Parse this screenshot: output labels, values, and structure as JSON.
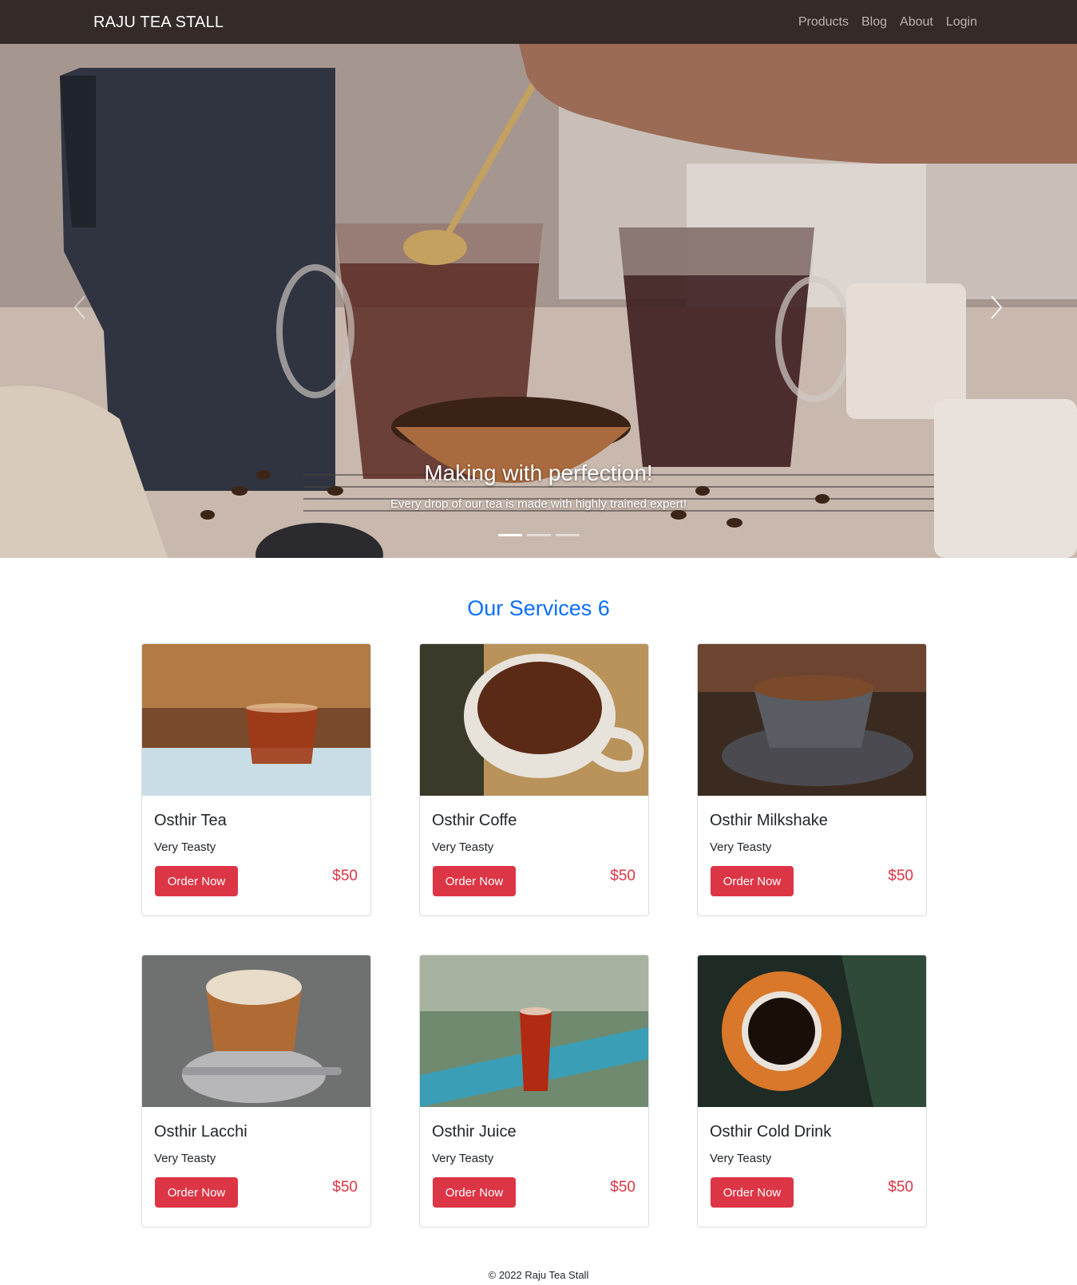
{
  "navbar": {
    "brand": "RAJU TEA STALL",
    "links": [
      "Products",
      "Blog",
      "About",
      "Login"
    ]
  },
  "hero": {
    "title": "Making with perfection!",
    "text": "Every drop of our tea is made with highly trained expert!",
    "slide_count": 3,
    "active_slide": 1,
    "prev_icon": "chevron-left-icon",
    "next_icon": "chevron-right-icon"
  },
  "services": {
    "title": "Our Services 6",
    "cards": [
      {
        "title": "Osthir Tea",
        "text": "Very Teasty",
        "button": "Order Now",
        "price": "$50"
      },
      {
        "title": "Osthir Coffe",
        "text": "Very Teasty",
        "button": "Order Now",
        "price": "$50"
      },
      {
        "title": "Osthir Milkshake",
        "text": "Very Teasty",
        "button": "Order Now",
        "price": "$50"
      },
      {
        "title": "Osthir Lacchi",
        "text": "Very Teasty",
        "button": "Order Now",
        "price": "$50"
      },
      {
        "title": "Osthir Juice",
        "text": "Very Teasty",
        "button": "Order Now",
        "price": "$50"
      },
      {
        "title": "Osthir Cold Drink",
        "text": "Very Teasty",
        "button": "Order Now",
        "price": "$50"
      }
    ]
  },
  "footer": {
    "text": "© 2022 Raju Tea Stall"
  },
  "colors": {
    "navbar_bg": "#342a28",
    "accent_blue": "#0d6efd",
    "button_red": "#dc3545"
  }
}
